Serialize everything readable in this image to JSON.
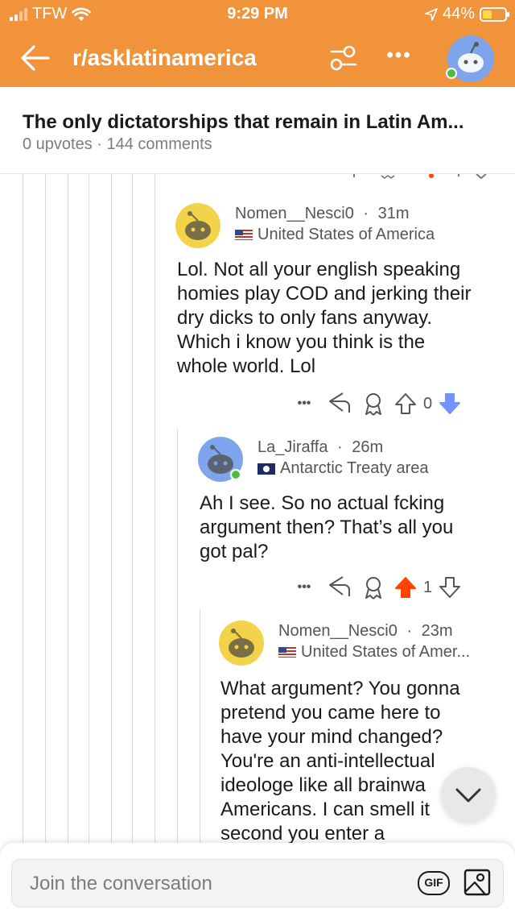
{
  "status_bar": {
    "carrier": "TFW",
    "time": "9:29 PM",
    "battery": "44%",
    "battery_level": 0.44
  },
  "header": {
    "subreddit": "r/asklatinamerica",
    "more_label": "•••"
  },
  "post": {
    "title": "The only dictatorships that remain in Latin Am...",
    "meta": "0 upvotes · 144 comments"
  },
  "comments": [
    {
      "author": "Nomen__Nesci0",
      "age": "31m",
      "flair": "United States of America",
      "body": "Lol. Not all your english speaking\nhomies play COD and jerking their\ndry dicks to only fans anyway.\nWhich i know you think is the\nwhole world. Lol",
      "score": "0",
      "vote": "down"
    },
    {
      "author": "La_Jiraffa",
      "age": "26m",
      "flair": "Antarctic Treaty area",
      "body": "Ah I see. So no actual fcking\nargument then? That’s all you\ngot pal?",
      "score": "1",
      "vote": "up"
    },
    {
      "author": "Nomen__Nesci0",
      "age": "23m",
      "flair": "United States of Amer...",
      "body": "What argument? You gonna\npretend you came here to\nhave your mind changed?\nYou're an anti-intellectual\nideologe like all brainwa\nAmericans. I can smell it\nsecond you enter a"
    }
  ],
  "separator": "·",
  "more_label": "•••",
  "compose": {
    "placeholder": "Join the conversation",
    "gif_label": "GIF"
  },
  "colors": {
    "header": "#f0933a",
    "upvote": "#ff4500",
    "downvote": "#7193ff",
    "online": "#4fbc48"
  }
}
